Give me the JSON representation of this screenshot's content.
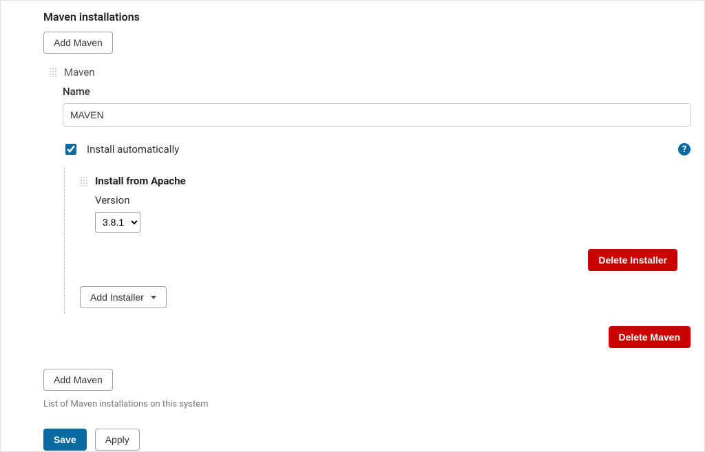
{
  "section": {
    "title": "Maven installations",
    "helper_text": "List of Maven installations on this system"
  },
  "buttons": {
    "add_maven": "Add Maven",
    "add_installer": "Add Installer",
    "delete_installer": "Delete Installer",
    "delete_maven": "Delete Maven",
    "save": "Save",
    "apply": "Apply"
  },
  "maven": {
    "header_label": "Maven",
    "name_label": "Name",
    "name_value": "MAVEN",
    "install_auto_label": "Install automatically",
    "install_auto_checked": true
  },
  "installer": {
    "title": "Install from Apache",
    "version_label": "Version",
    "version_selected": "3.8.1",
    "version_options": [
      "3.8.1"
    ]
  },
  "help": {
    "glyph": "?"
  }
}
